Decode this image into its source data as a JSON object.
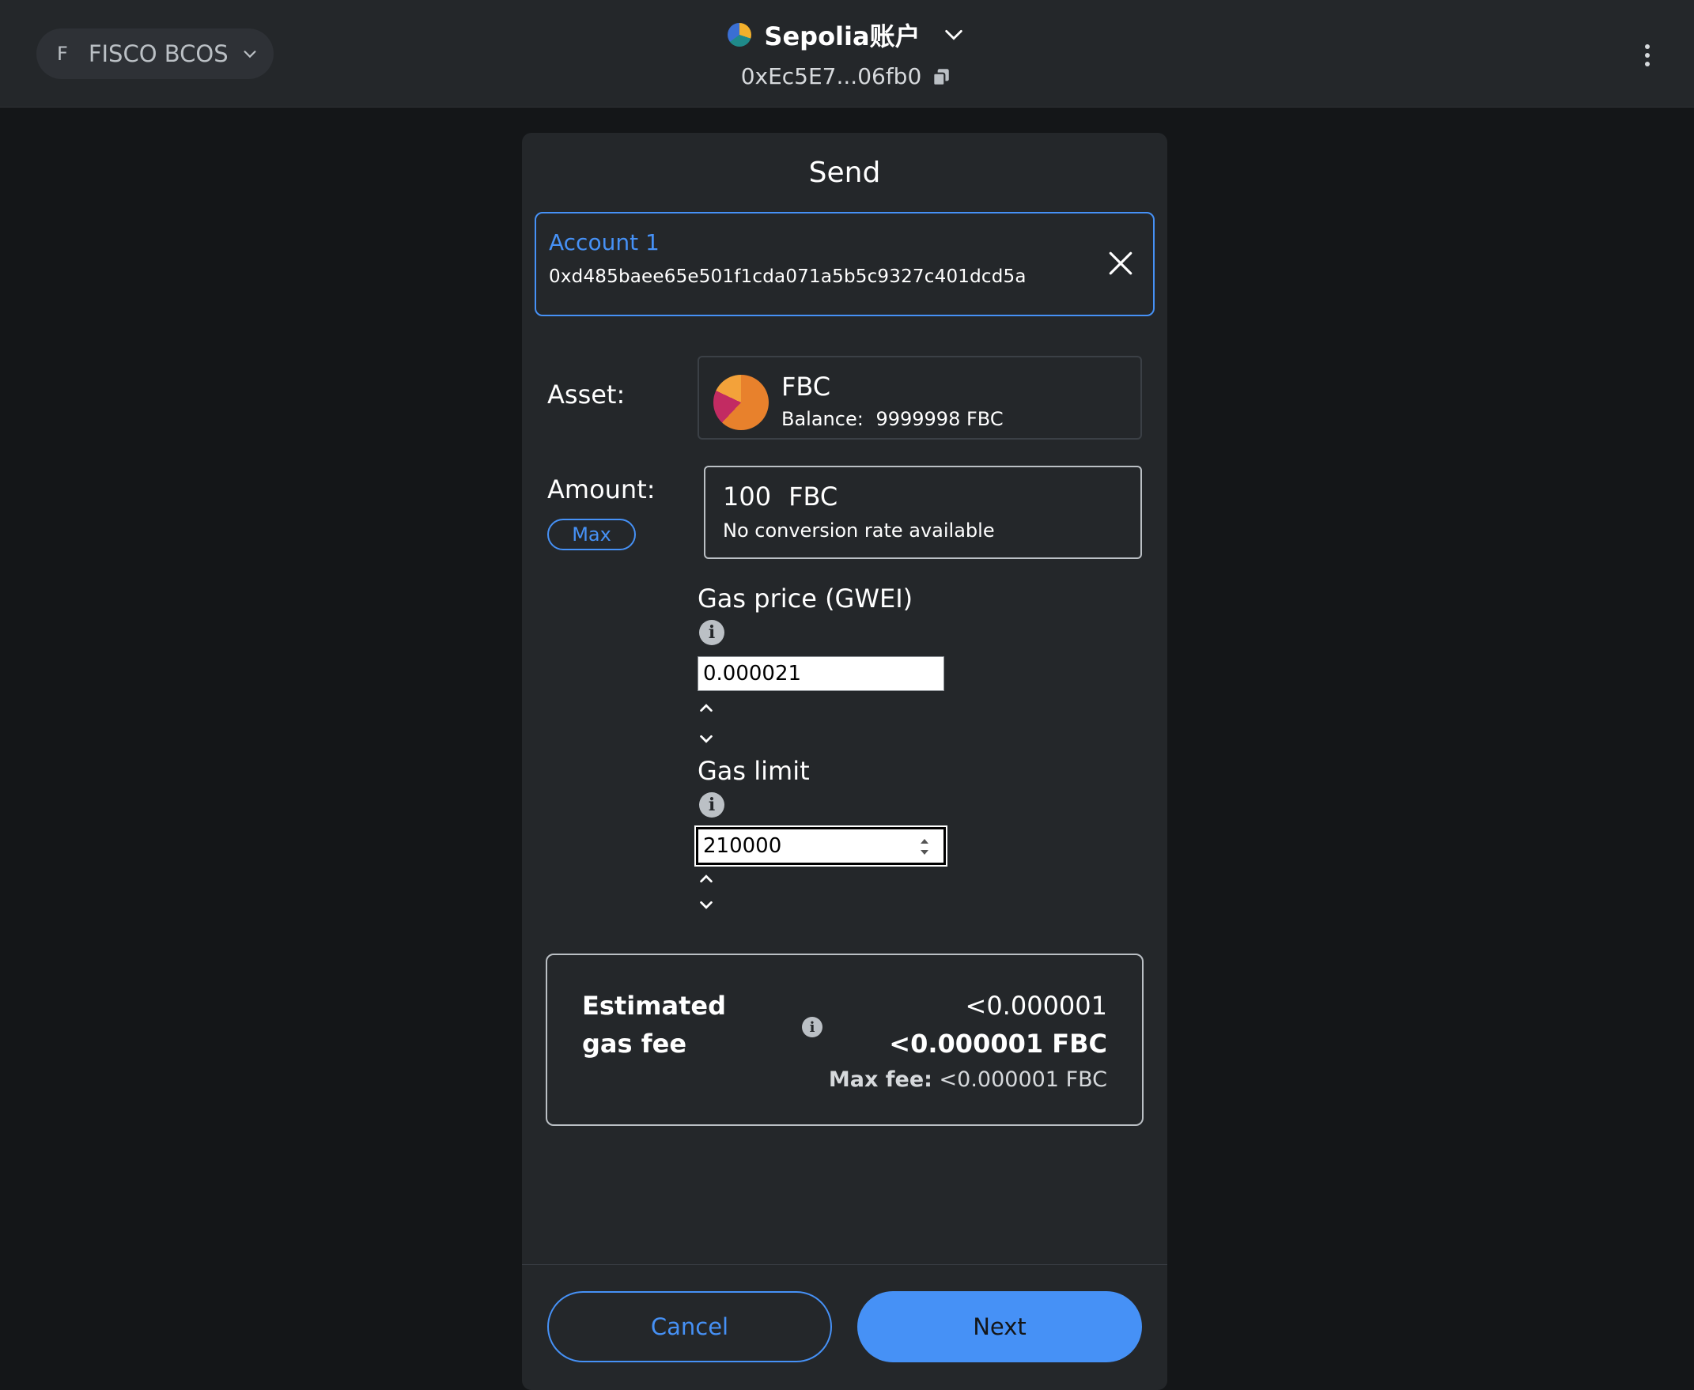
{
  "header": {
    "network": {
      "initial": "F",
      "name": "FISCO BCOS"
    },
    "account": {
      "name": "Sepolia账户",
      "address": "0xEc5E7...06fb0"
    }
  },
  "send": {
    "title": "Send",
    "recipient": {
      "name": "Account 1",
      "address": "0xd485baee65e501f1cda071a5b5c9327c401dcd5a"
    },
    "asset": {
      "label": "Asset:",
      "symbol": "FBC",
      "balance_label": "Balance:",
      "balance_value": "9999998 FBC"
    },
    "amount": {
      "label": "Amount:",
      "max_label": "Max",
      "value": "100",
      "unit": "FBC",
      "conversion": "No conversion rate available"
    },
    "gas_price": {
      "label": "Gas price (GWEI)",
      "value": "0.000021"
    },
    "gas_limit": {
      "label": "Gas limit",
      "value": "210000"
    },
    "fee": {
      "title": "Estimated gas fee",
      "secondary": "<0.000001",
      "primary": "<0.000001 FBC",
      "max_label": "Max fee:",
      "max_value": "<0.000001 FBC"
    },
    "buttons": {
      "cancel": "Cancel",
      "next": "Next"
    }
  },
  "colors": {
    "accent": "#4691f6",
    "background": "#141618",
    "surface": "#24272a",
    "topbar": "#24272a"
  },
  "icons": [
    "chevron-down-icon",
    "account-avatar-icon",
    "copy-icon",
    "kebab-menu-icon",
    "close-icon",
    "token-icon",
    "info-icon",
    "spin-arrows-icon",
    "stepper-up-icon",
    "stepper-down-icon"
  ]
}
